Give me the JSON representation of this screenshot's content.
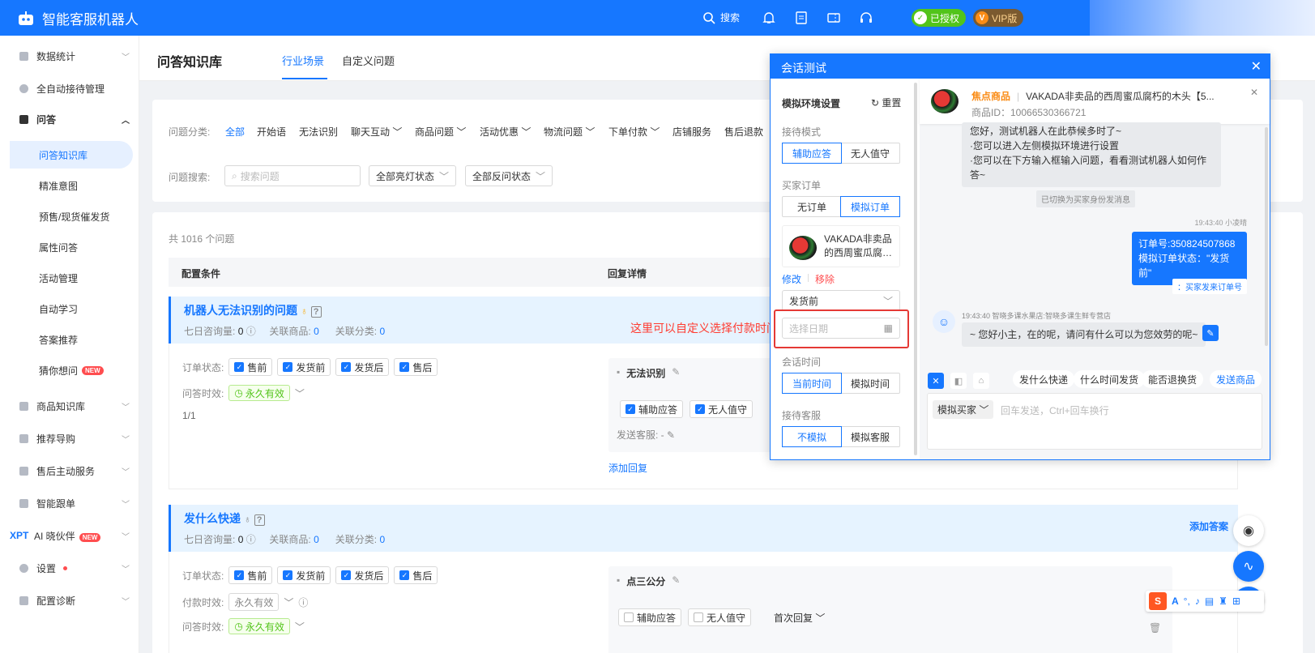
{
  "app": {
    "title": "智能客服机器人",
    "search": "搜索",
    "authorized": "已授权",
    "vip": "VIP版"
  },
  "sidebar": {
    "items": [
      {
        "label": "数据统计"
      },
      {
        "label": "全自动接待管理"
      },
      {
        "label": "问答"
      },
      {
        "label": "商品知识库"
      },
      {
        "label": "推荐导购"
      },
      {
        "label": "售后主动服务"
      },
      {
        "label": "智能跟单"
      },
      {
        "label": "AI 晓伙伴",
        "prefix": "XPT",
        "badge": "NEW"
      },
      {
        "label": "设置"
      },
      {
        "label": "配置诊断"
      }
    ],
    "sub": [
      {
        "label": "问答知识库"
      },
      {
        "label": "精准意图"
      },
      {
        "label": "预售/现货催发货"
      },
      {
        "label": "属性问答"
      },
      {
        "label": "活动管理"
      },
      {
        "label": "自动学习"
      },
      {
        "label": "答案推荐"
      },
      {
        "label": "猜你想问",
        "badge": "NEW"
      }
    ]
  },
  "page": {
    "title": "问答知识库",
    "tabs": [
      "行业场景",
      "自定义问题"
    ]
  },
  "filter": {
    "category_label": "问题分类:",
    "categories": [
      "全部",
      "开始语",
      "无法识别",
      "聊天互动",
      "商品问题",
      "活动优惠",
      "物流问题",
      "下单付款",
      "店铺服务",
      "售后退款"
    ],
    "search_label": "问题搜索:",
    "search_placeholder": "搜索问题",
    "light_status": "全部亮灯状态",
    "reverse_status": "全部反问状态"
  },
  "list": {
    "total": "共 1016 个问题",
    "col_condition": "配置条件",
    "col_reply": "回复详情",
    "add_answer": "添加答案",
    "groups": [
      {
        "title": "机器人无法识别的问题",
        "consult_label": "七日咨询量:",
        "consult": "0",
        "related_goods_label": "关联商品:",
        "related_goods": "0",
        "related_cat_label": "关联分类:",
        "related_cat": "0",
        "order_status_label": "订单状态:",
        "statuses": [
          "售前",
          "发货前",
          "发货后",
          "售后"
        ],
        "validity_label": "问答时效:",
        "validity": "永久有效",
        "page": "1/1",
        "reply_name": "无法识别",
        "reply_opts": [
          "辅助应答",
          "无人值守"
        ],
        "send_service": "发送客服: -",
        "add_reply": "添加回复"
      },
      {
        "title": "发什么快递",
        "consult_label": "七日咨询量:",
        "consult": "0",
        "related_goods_label": "关联商品:",
        "related_goods": "0",
        "related_cat_label": "关联分类:",
        "related_cat": "0",
        "order_status_label": "订单状态:",
        "statuses": [
          "售前",
          "发货前",
          "发货后",
          "售后"
        ],
        "pay_label": "付款时效:",
        "pay_validity": "永久有效",
        "validity_label": "问答时效:",
        "validity": "永久有效",
        "reply_name": "点三公分",
        "reply_opts": [
          "辅助应答",
          "无人值守"
        ],
        "first_reply": "首次回复"
      }
    ]
  },
  "annotation": "这里可以自定义选择付款时间",
  "dialog": {
    "title": "会话测试",
    "env_title": "模拟环境设置",
    "reset": "重置",
    "mode_label": "接待模式",
    "mode_opts": [
      "辅助应答",
      "无人值守"
    ],
    "order_label": "买家订单",
    "order_opts": [
      "无订单",
      "模拟订单"
    ],
    "product_name": "VAKADA非卖品的西周蜜瓜腐…",
    "modify": "修改",
    "remove": "移除",
    "order_state": "发货前",
    "date_placeholder": "选择日期",
    "session_time_label": "会话时间",
    "session_time_opts": [
      "当前时间",
      "模拟时间"
    ],
    "service_label": "接待客服",
    "service_opts": [
      "不模拟",
      "模拟客服"
    ],
    "hot_tag": "焦点商品",
    "hot_product": "VAKADA非卖品的西周蜜瓜腐朽的木头【5...",
    "product_id": "商品ID：10066530366721",
    "msg_bot_intro": [
      "您好，测试机器人在此恭候多时了~",
      "·您可以进入左侧模拟环境进行设置",
      "·您可以在下方输入框输入问题，看看测试机器人如何作答~"
    ],
    "msg_system": "已切换为买家身份发消息",
    "msg_user_meta": "19:43:40 小凌晴",
    "msg_user": [
      "订单号:350824507868",
      "模拟订单状态：\"发货前\""
    ],
    "msg_user_tag": "：买家发来订单号",
    "msg_bot_meta": "19:43:40 智晓多课水果店:智晓多课生鲜专营店",
    "msg_bot": "~ 您好小主，在的呢，请问有什么可以为您效劳的呢~",
    "quick": [
      "发什么快递",
      "什么时间发货",
      "能否退换货",
      "发送商品"
    ],
    "buyer_select": "模拟买家",
    "input_placeholder": "回车发送，Ctrl+回车换行"
  },
  "ime": {
    "label": "A"
  }
}
